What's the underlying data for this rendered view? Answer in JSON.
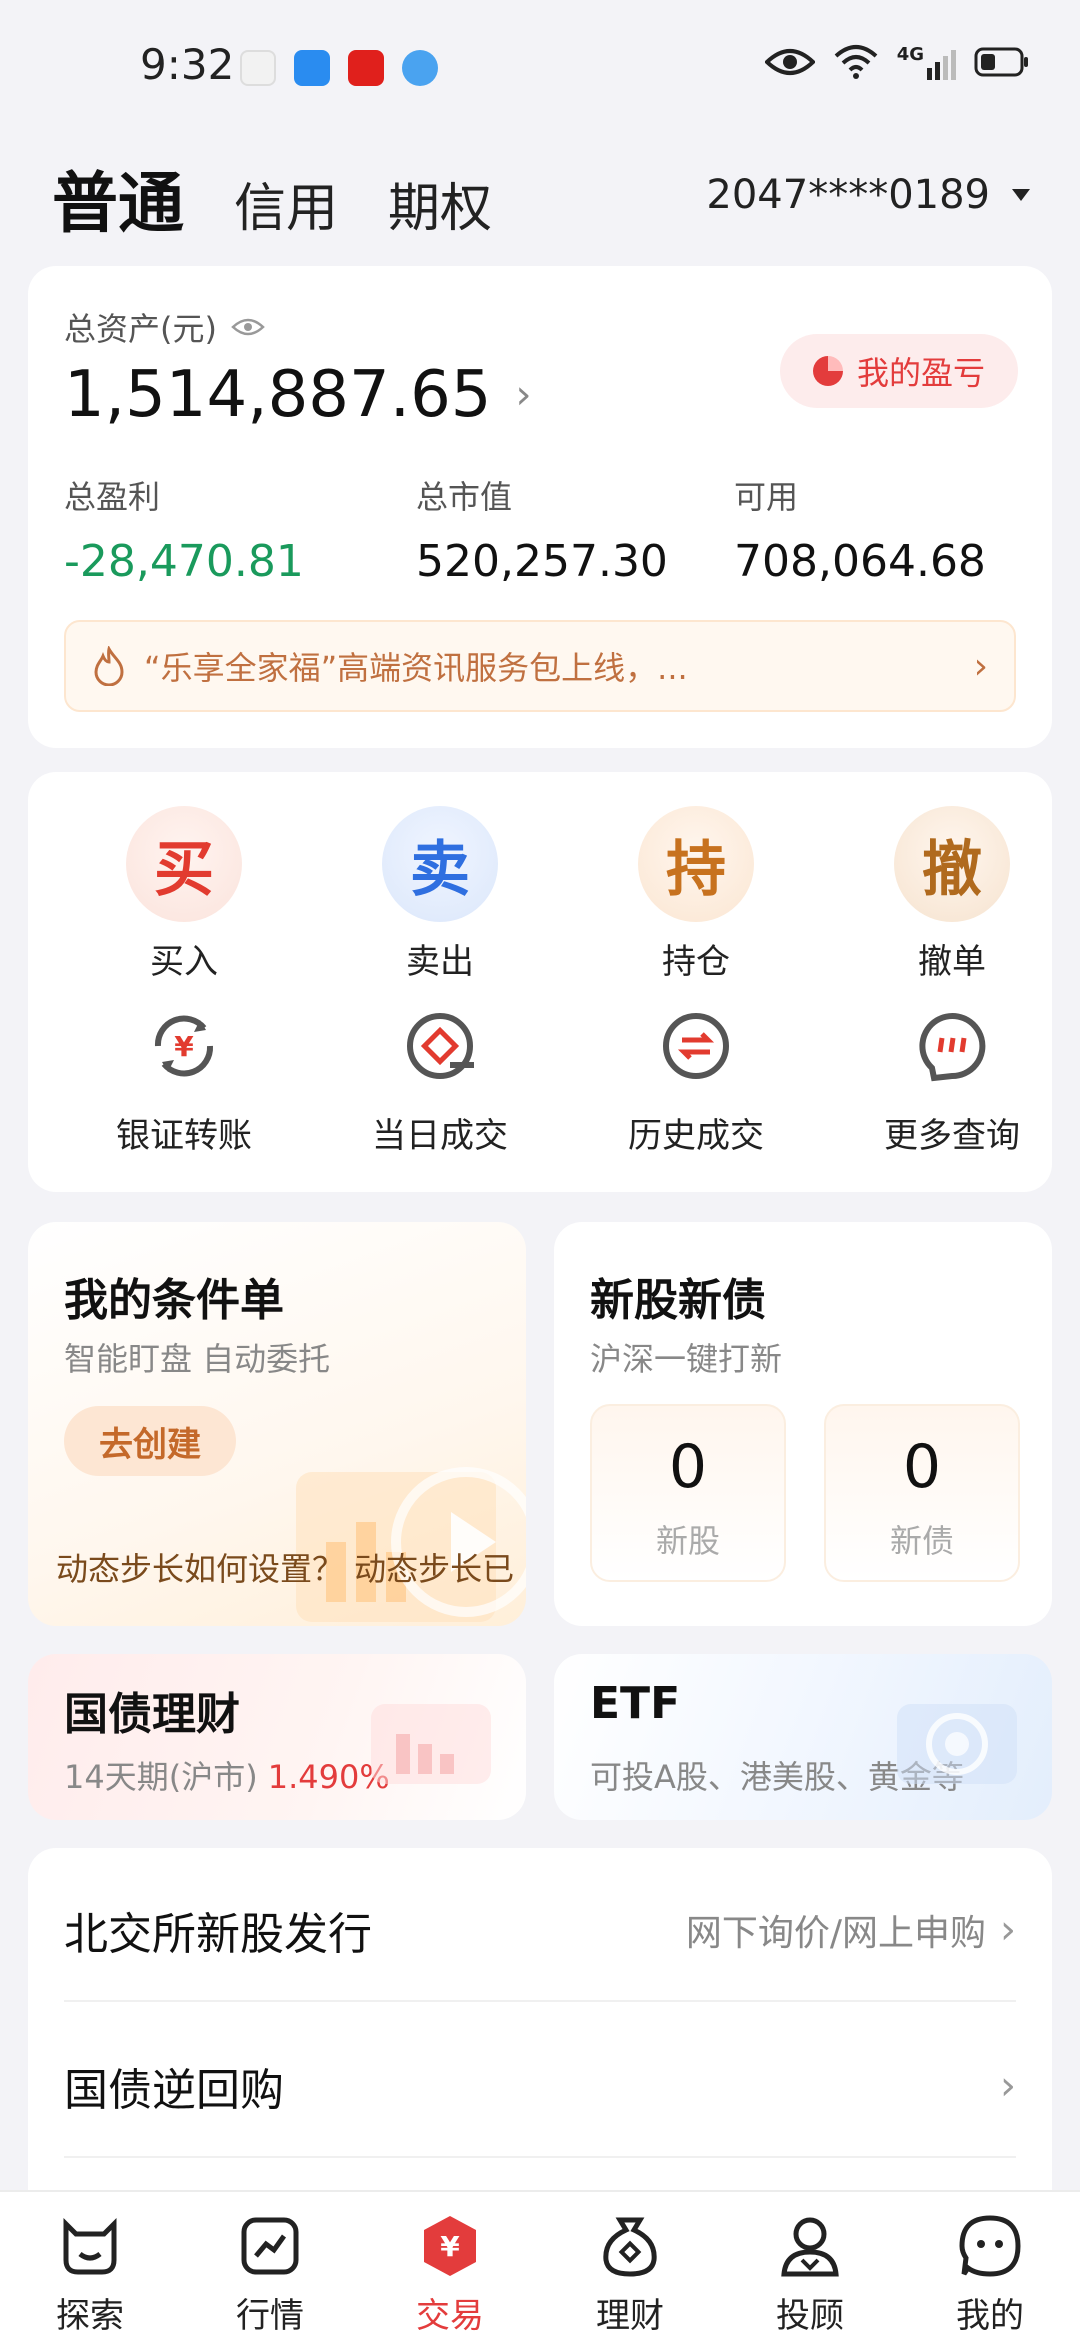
{
  "status_bar": {
    "time": "9:32",
    "network": "4G",
    "icons": [
      "feather-icon",
      "message-icon",
      "pinduoduo-icon",
      "browser-icon",
      "eye-icon",
      "wifi-icon",
      "signal-icon",
      "battery-icon"
    ]
  },
  "account": {
    "tabs": [
      "普通",
      "信用",
      "期权"
    ],
    "active_tab": "普通",
    "number": "2047****0189"
  },
  "assets": {
    "label": "总资产(元)",
    "total": "1,514,887.65",
    "pnl_button": "我的盈亏",
    "stats": [
      {
        "label": "总盈利",
        "value": "-28,470.81",
        "color": "#1a9a5c"
      },
      {
        "label": "总市值",
        "value": "520,257.30"
      },
      {
        "label": "可用",
        "value": "708,064.68"
      }
    ],
    "notice": "“乐享全家福”高端资讯服务包上线，..."
  },
  "actions": {
    "primary": [
      {
        "glyph": "买",
        "label": "买入"
      },
      {
        "glyph": "卖",
        "label": "卖出"
      },
      {
        "glyph": "持",
        "label": "持仓"
      },
      {
        "glyph": "撤",
        "label": "撤单"
      }
    ],
    "tools": [
      {
        "icon": "bank-transfer-icon",
        "label": "银证转账"
      },
      {
        "icon": "today-deal-icon",
        "label": "当日成交"
      },
      {
        "icon": "history-deal-icon",
        "label": "历史成交"
      },
      {
        "icon": "more-query-icon",
        "label": "更多查询"
      }
    ]
  },
  "condition": {
    "title": "我的条件单",
    "subtitle": "智能盯盘 自动委托",
    "button": "去创建",
    "ticker": "动态步长如何设置？ 动态步长已"
  },
  "ipo": {
    "title": "新股新债",
    "subtitle": "沪深一键打新",
    "boxes": [
      {
        "count": "0",
        "label": "新股"
      },
      {
        "count": "0",
        "label": "新债"
      }
    ]
  },
  "bond": {
    "title": "国债理财",
    "subtitle": "14天期(沪市)",
    "rate": "1.490%"
  },
  "etf": {
    "title": "ETF",
    "subtitle": "可投A股、港美股、黄金等"
  },
  "list": [
    {
      "title": "北交所新股发行",
      "right": "网下询价/网上申购"
    },
    {
      "title": "国债逆回购",
      "right": ""
    }
  ],
  "bottom_nav": [
    {
      "label": "探索",
      "icon": "explore-icon"
    },
    {
      "label": "行情",
      "icon": "market-icon"
    },
    {
      "label": "交易",
      "icon": "trade-icon",
      "active": true
    },
    {
      "label": "理财",
      "icon": "wealth-icon"
    },
    {
      "label": "投顾",
      "icon": "advisor-icon"
    },
    {
      "label": "我的",
      "icon": "profile-icon"
    }
  ],
  "colors": {
    "accent_red": "#e33c3c",
    "profit_green": "#1a9a5c",
    "notice_orange": "#c07040"
  }
}
